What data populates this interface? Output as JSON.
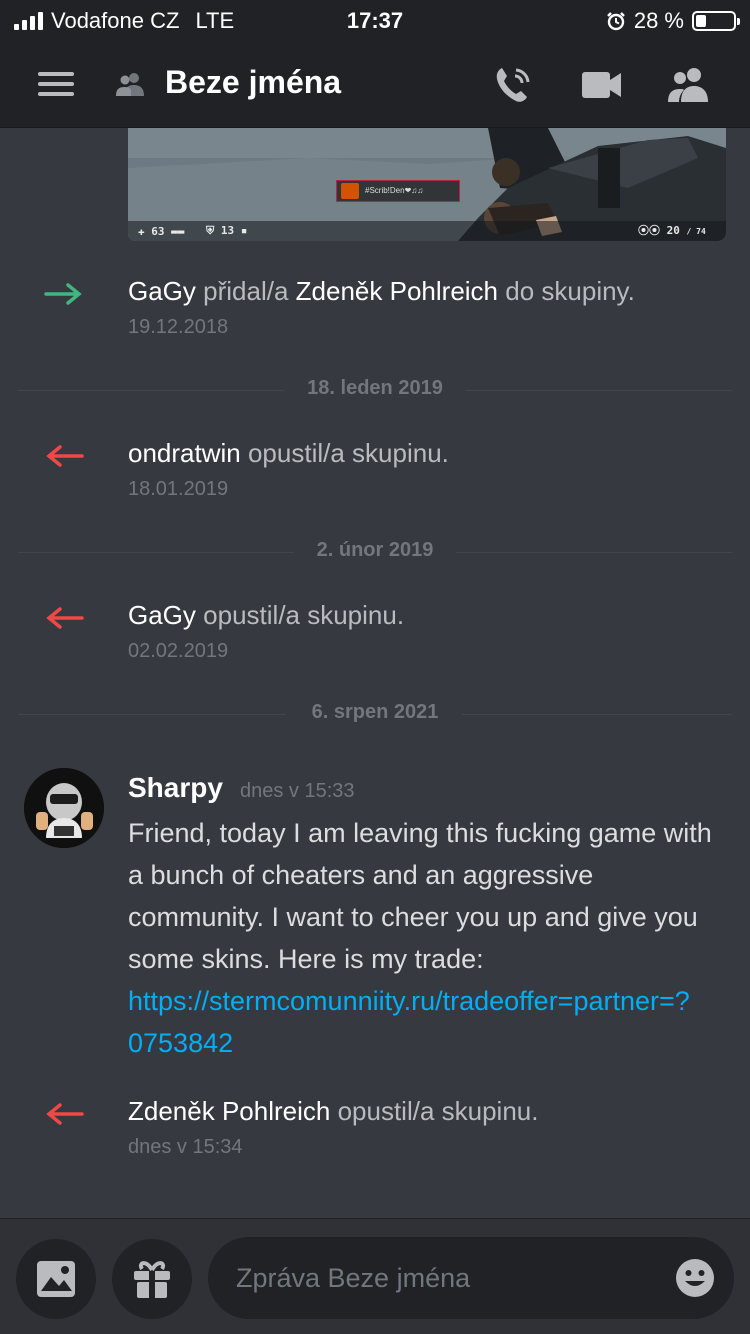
{
  "status_bar": {
    "carrier": "Vodafone CZ",
    "network": "LTE",
    "time": "17:37",
    "battery": "28 %",
    "battery_fraction": 0.28
  },
  "header": {
    "title": "Beze jména",
    "icons": [
      "menu-icon",
      "group-dm-icon",
      "call-icon",
      "video-icon",
      "members-icon"
    ]
  },
  "embed": {
    "hud_health": "63",
    "hud_armor": "13",
    "hud_ammo": "20",
    "hud_reserve": "/ 74",
    "killfeed_text": "#Scrib!Den❤♫♫"
  },
  "events": [
    {
      "direction": "join",
      "actor": "GaGy",
      "verb": "přidal/a",
      "target": "Zdeněk Pohlreich",
      "suffix": "do skupiny.",
      "timestamp": "19.12.2018"
    },
    {
      "direction": "leave",
      "actor": "ondratwin",
      "verb": "opustil/a skupinu.",
      "timestamp": "18.01.2019"
    },
    {
      "direction": "leave",
      "actor": "GaGy",
      "verb": "opustil/a skupinu.",
      "timestamp": "02.02.2019"
    },
    {
      "direction": "leave",
      "actor": "Zdeněk Pohlreich",
      "verb": "opustil/a skupinu.",
      "timestamp": "dnes v 15:34"
    }
  ],
  "dividers": [
    "18. leden 2019",
    "2. únor 2019",
    "6. srpen 2021"
  ],
  "message": {
    "author": "Sharpy",
    "timestamp": "dnes v 15:33",
    "text": "Friend, today I am leaving this fucking game with a bunch of cheaters and an aggressive community. I want to cheer you up and give you some skins. Here is my trade: ",
    "link": "https://stermcomunniity.ru/tradeoffer=partner=?0753842"
  },
  "composer": {
    "placeholder": "Zpráva Beze jména"
  },
  "colors": {
    "background": "#36393f",
    "header": "#202225",
    "join_arrow": "#43b581",
    "leave_arrow": "#f04747",
    "link": "#00aff4"
  }
}
